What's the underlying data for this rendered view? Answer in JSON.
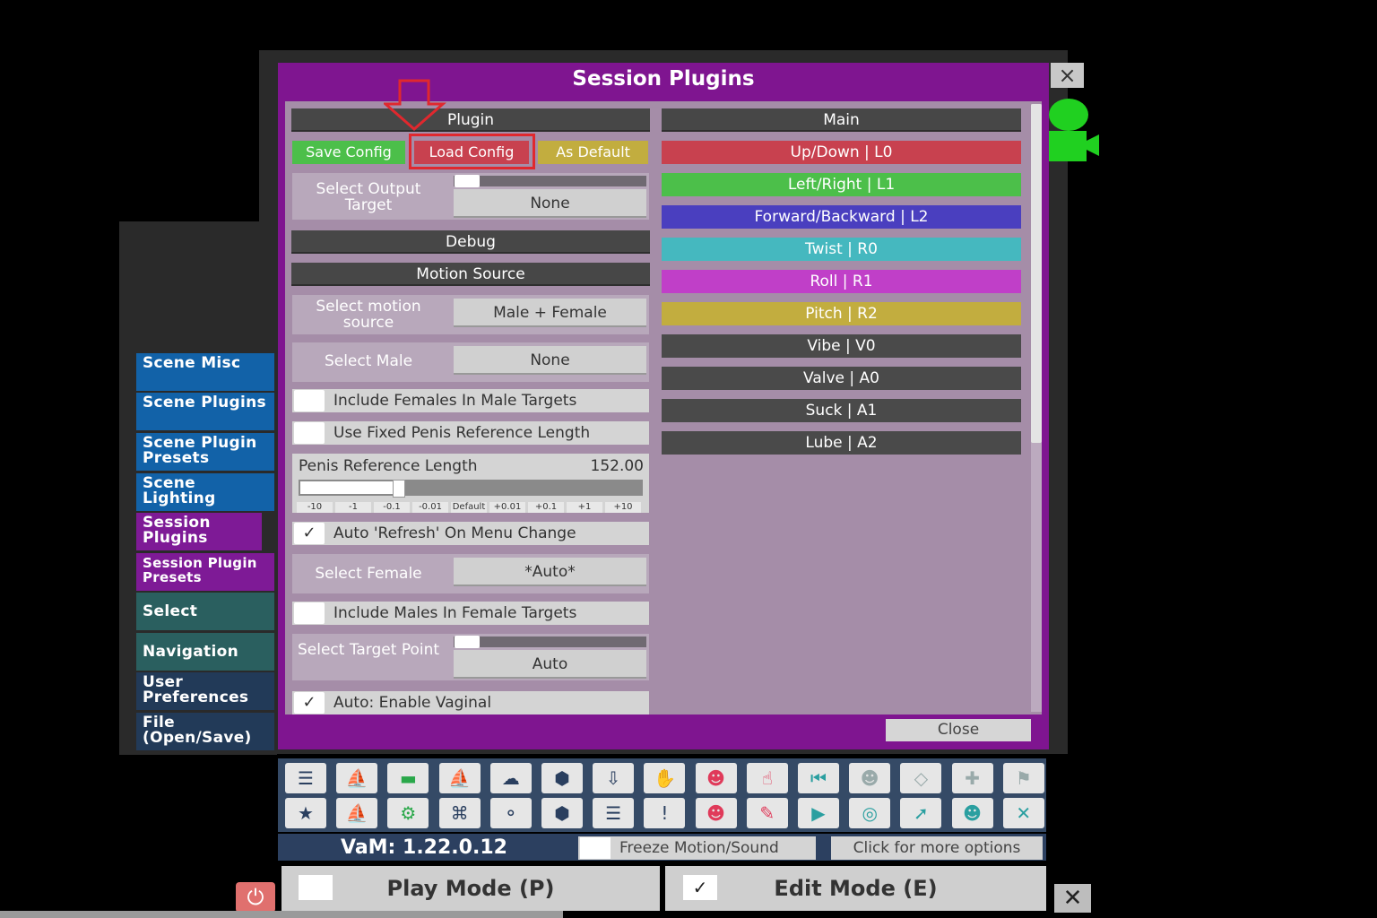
{
  "window": {
    "title": "Session Plugins",
    "close_x": "×"
  },
  "sidenav": {
    "items": [
      {
        "label": "Scene Misc"
      },
      {
        "label": "Scene Plugins"
      },
      {
        "label": "Scene Plugin Presets"
      },
      {
        "label": "Scene Lighting"
      },
      {
        "label": "Session Plugins"
      },
      {
        "label": "Session Plugin Presets"
      },
      {
        "label": "Select"
      },
      {
        "label": "Navigation"
      },
      {
        "label": "User Preferences"
      },
      {
        "label": "File (Open/Save)"
      }
    ]
  },
  "plugin": {
    "header": "Plugin",
    "save_config": "Save Config",
    "load_config": "Load Config",
    "as_default": "As Default",
    "select_output_label": "Select Output Target",
    "select_output_value": "None",
    "debug_header": "Debug",
    "motion_source_header": "Motion Source",
    "select_motion_label": "Select motion source",
    "select_motion_value": "Male + Female",
    "select_male_label": "Select Male",
    "select_male_value": "None",
    "include_females": "Include Females In Male Targets",
    "use_fixed_penis": "Use Fixed Penis Reference Length",
    "penis_ref_label": "Penis Reference Length",
    "penis_ref_value": "152.00",
    "penis_ref_fraction": 0.27,
    "ticks": [
      "-10",
      "-1",
      "-0.1",
      "-0.01",
      "Default",
      "+0.01",
      "+0.1",
      "+1",
      "+10"
    ],
    "auto_refresh": "Auto 'Refresh' On Menu Change",
    "auto_refresh_check": "✓",
    "select_female_label": "Select Female",
    "select_female_value": "*Auto*",
    "include_males": "Include Males In Female Targets",
    "select_target_label": "Select Target Point",
    "select_target_value": "Auto",
    "auto_vaginal": "Auto: Enable Vaginal",
    "auto_vaginal_check": "✓"
  },
  "main": {
    "header": "Main",
    "axes": [
      {
        "label": "Up/Down | L0",
        "color": "#c8414f"
      },
      {
        "label": "Left/Right | L1",
        "color": "#4cbf4a"
      },
      {
        "label": "Forward/Backward | L2",
        "color": "#4a3fbf"
      },
      {
        "label": "Twist | R0",
        "color": "#45b8bf"
      },
      {
        "label": "Roll | R1",
        "color": "#c03fc8"
      },
      {
        "label": "Pitch | R2",
        "color": "#c2ad3f"
      },
      {
        "label": "Vibe | V0",
        "color": "#4a4a4a"
      },
      {
        "label": "Valve | A0",
        "color": "#4a4a4a"
      },
      {
        "label": "Suck | A1",
        "color": "#4a4a4a"
      },
      {
        "label": "Lube | A2",
        "color": "#4a4a4a"
      }
    ]
  },
  "close_label": "Close",
  "footer": {
    "version": "VaM: 1.22.0.12",
    "freeze": "Freeze Motion/Sound",
    "more_options": "Click for more options",
    "play_mode": "Play Mode (P)",
    "edit_mode": "Edit Mode (E)",
    "edit_check": "✓",
    "x": "✕"
  }
}
